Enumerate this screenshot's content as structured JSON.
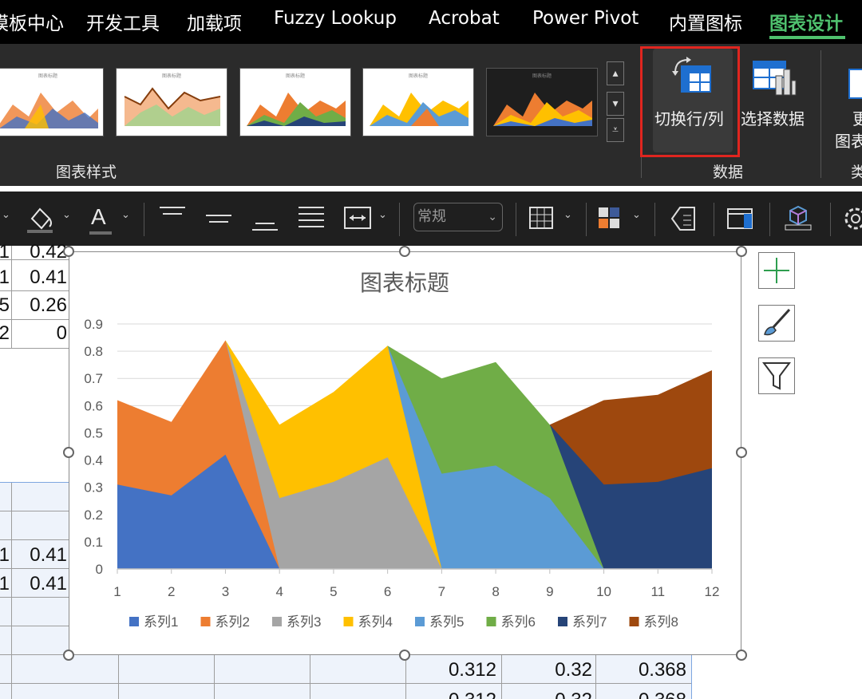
{
  "menu": {
    "items": [
      "模板中心",
      "开发工具",
      "加载项",
      "Fuzzy Lookup",
      "Acrobat",
      "Power Pivot",
      "内置图标",
      "图表设计"
    ],
    "active": "图表设计"
  },
  "ribbon": {
    "chart_styles_label": "图表样式",
    "data_group_label": "数据",
    "switch_row_col_label": "切换行/列",
    "select_data_label": "选择数据",
    "partial_change_type_line1": "更",
    "partial_change_type_line2": "图表",
    "partial_type_group": "类",
    "highlight_color": "#e0251f",
    "thumb_titles": [
      "图表标题",
      "图表标题",
      "图表标题",
      "图表标题",
      "图表标题"
    ]
  },
  "toolbar": {
    "number_format": "常规",
    "font_color_glyph": "A"
  },
  "sheet": {
    "top_rows": [
      {
        "left": "1",
        "right": "0.42"
      },
      {
        "left": "1",
        "right": "0.41"
      },
      {
        "left": "5",
        "right": "0.26"
      },
      {
        "left": "2",
        "right": "0"
      }
    ],
    "middle_rows": [
      {
        "left": "1",
        "right": "0.41"
      },
      {
        "left": "1",
        "right": "0.41"
      }
    ],
    "bottom_row": [
      "0.312",
      "0.32",
      "0.368"
    ],
    "cut_row": [
      "0.312",
      "0.32",
      "0.368"
    ]
  },
  "chart_data": {
    "type": "area",
    "title": "图表标题",
    "xlabel": "",
    "ylabel": "",
    "x": [
      1,
      2,
      3,
      4,
      5,
      6,
      7,
      8,
      9,
      10,
      11,
      12
    ],
    "ylim": [
      0,
      0.9
    ],
    "yticks": [
      "0",
      "0.1",
      "0.2",
      "0.3",
      "0.4",
      "0.5",
      "0.6",
      "0.7",
      "0.8",
      "0.9"
    ],
    "grid": true,
    "legend": "bottom",
    "series": [
      {
        "name": "系列1",
        "color": "#4472c4",
        "values": [
          0.31,
          0.27,
          0.42,
          0,
          null,
          null,
          null,
          null,
          null,
          null,
          null,
          null
        ]
      },
      {
        "name": "系列2",
        "color": "#ed7d31",
        "values": [
          0.62,
          0.54,
          0.84,
          0,
          null,
          null,
          null,
          null,
          null,
          null,
          null,
          null
        ]
      },
      {
        "name": "系列3",
        "color": "#a5a5a5",
        "values": [
          null,
          null,
          0.84,
          0.26,
          0.32,
          0.41,
          0,
          null,
          null,
          null,
          null,
          null
        ]
      },
      {
        "name": "系列4",
        "color": "#ffc000",
        "values": [
          null,
          null,
          0.84,
          0.53,
          0.65,
          0.82,
          0,
          null,
          null,
          null,
          null,
          null
        ]
      },
      {
        "name": "系列5",
        "color": "#5b9bd5",
        "values": [
          null,
          null,
          null,
          null,
          null,
          0.82,
          0.35,
          0.38,
          0.26,
          0,
          null,
          null
        ]
      },
      {
        "name": "系列6",
        "color": "#70ad47",
        "values": [
          null,
          null,
          null,
          null,
          null,
          0.82,
          0.7,
          0.76,
          0.53,
          0,
          null,
          null
        ]
      },
      {
        "name": "系列7",
        "color": "#264478",
        "values": [
          null,
          null,
          null,
          null,
          null,
          null,
          null,
          null,
          0.53,
          0.31,
          0.32,
          0.37
        ]
      },
      {
        "name": "系列8",
        "color": "#9e480e",
        "values": [
          null,
          null,
          null,
          null,
          null,
          null,
          null,
          null,
          0.53,
          0.62,
          0.64,
          0.73
        ]
      }
    ]
  }
}
